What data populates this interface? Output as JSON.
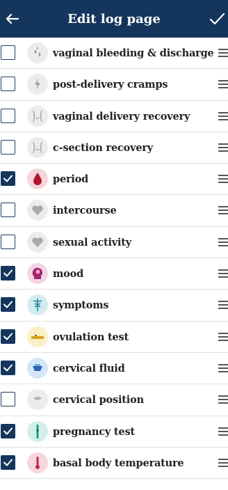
{
  "header": {
    "title": "Edit log page",
    "back_icon": "arrow-left-icon",
    "done_icon": "checkmark-icon",
    "background": "#15365c"
  },
  "items": [
    {
      "label": "vaginal bleeding & discharge",
      "checked": false,
      "icon": "droplets-icon"
    },
    {
      "label": "post-delivery cramps",
      "checked": false,
      "icon": "lightning-icon"
    },
    {
      "label": "vaginal delivery recovery",
      "checked": false,
      "icon": "body-outline-icon"
    },
    {
      "label": "c-section recovery",
      "checked": false,
      "icon": "body-incision-icon"
    },
    {
      "label": "period",
      "checked": true,
      "icon": "blood-drop-icon"
    },
    {
      "label": "intercourse",
      "checked": false,
      "icon": "heart-icon"
    },
    {
      "label": "sexual activity",
      "checked": false,
      "icon": "heart-icon"
    },
    {
      "label": "mood",
      "checked": true,
      "icon": "head-brain-icon"
    },
    {
      "label": "symptoms",
      "checked": true,
      "icon": "caduceus-icon"
    },
    {
      "label": "ovulation test",
      "checked": true,
      "icon": "test-strip-icon"
    },
    {
      "label": "cervical fluid",
      "checked": true,
      "icon": "fluid-gem-icon"
    },
    {
      "label": "cervical position",
      "checked": false,
      "icon": "cervix-icon"
    },
    {
      "label": "pregnancy test",
      "checked": true,
      "icon": "test-stick-icon"
    },
    {
      "label": "basal body temperature",
      "checked": true,
      "icon": "thermometer-icon"
    }
  ]
}
